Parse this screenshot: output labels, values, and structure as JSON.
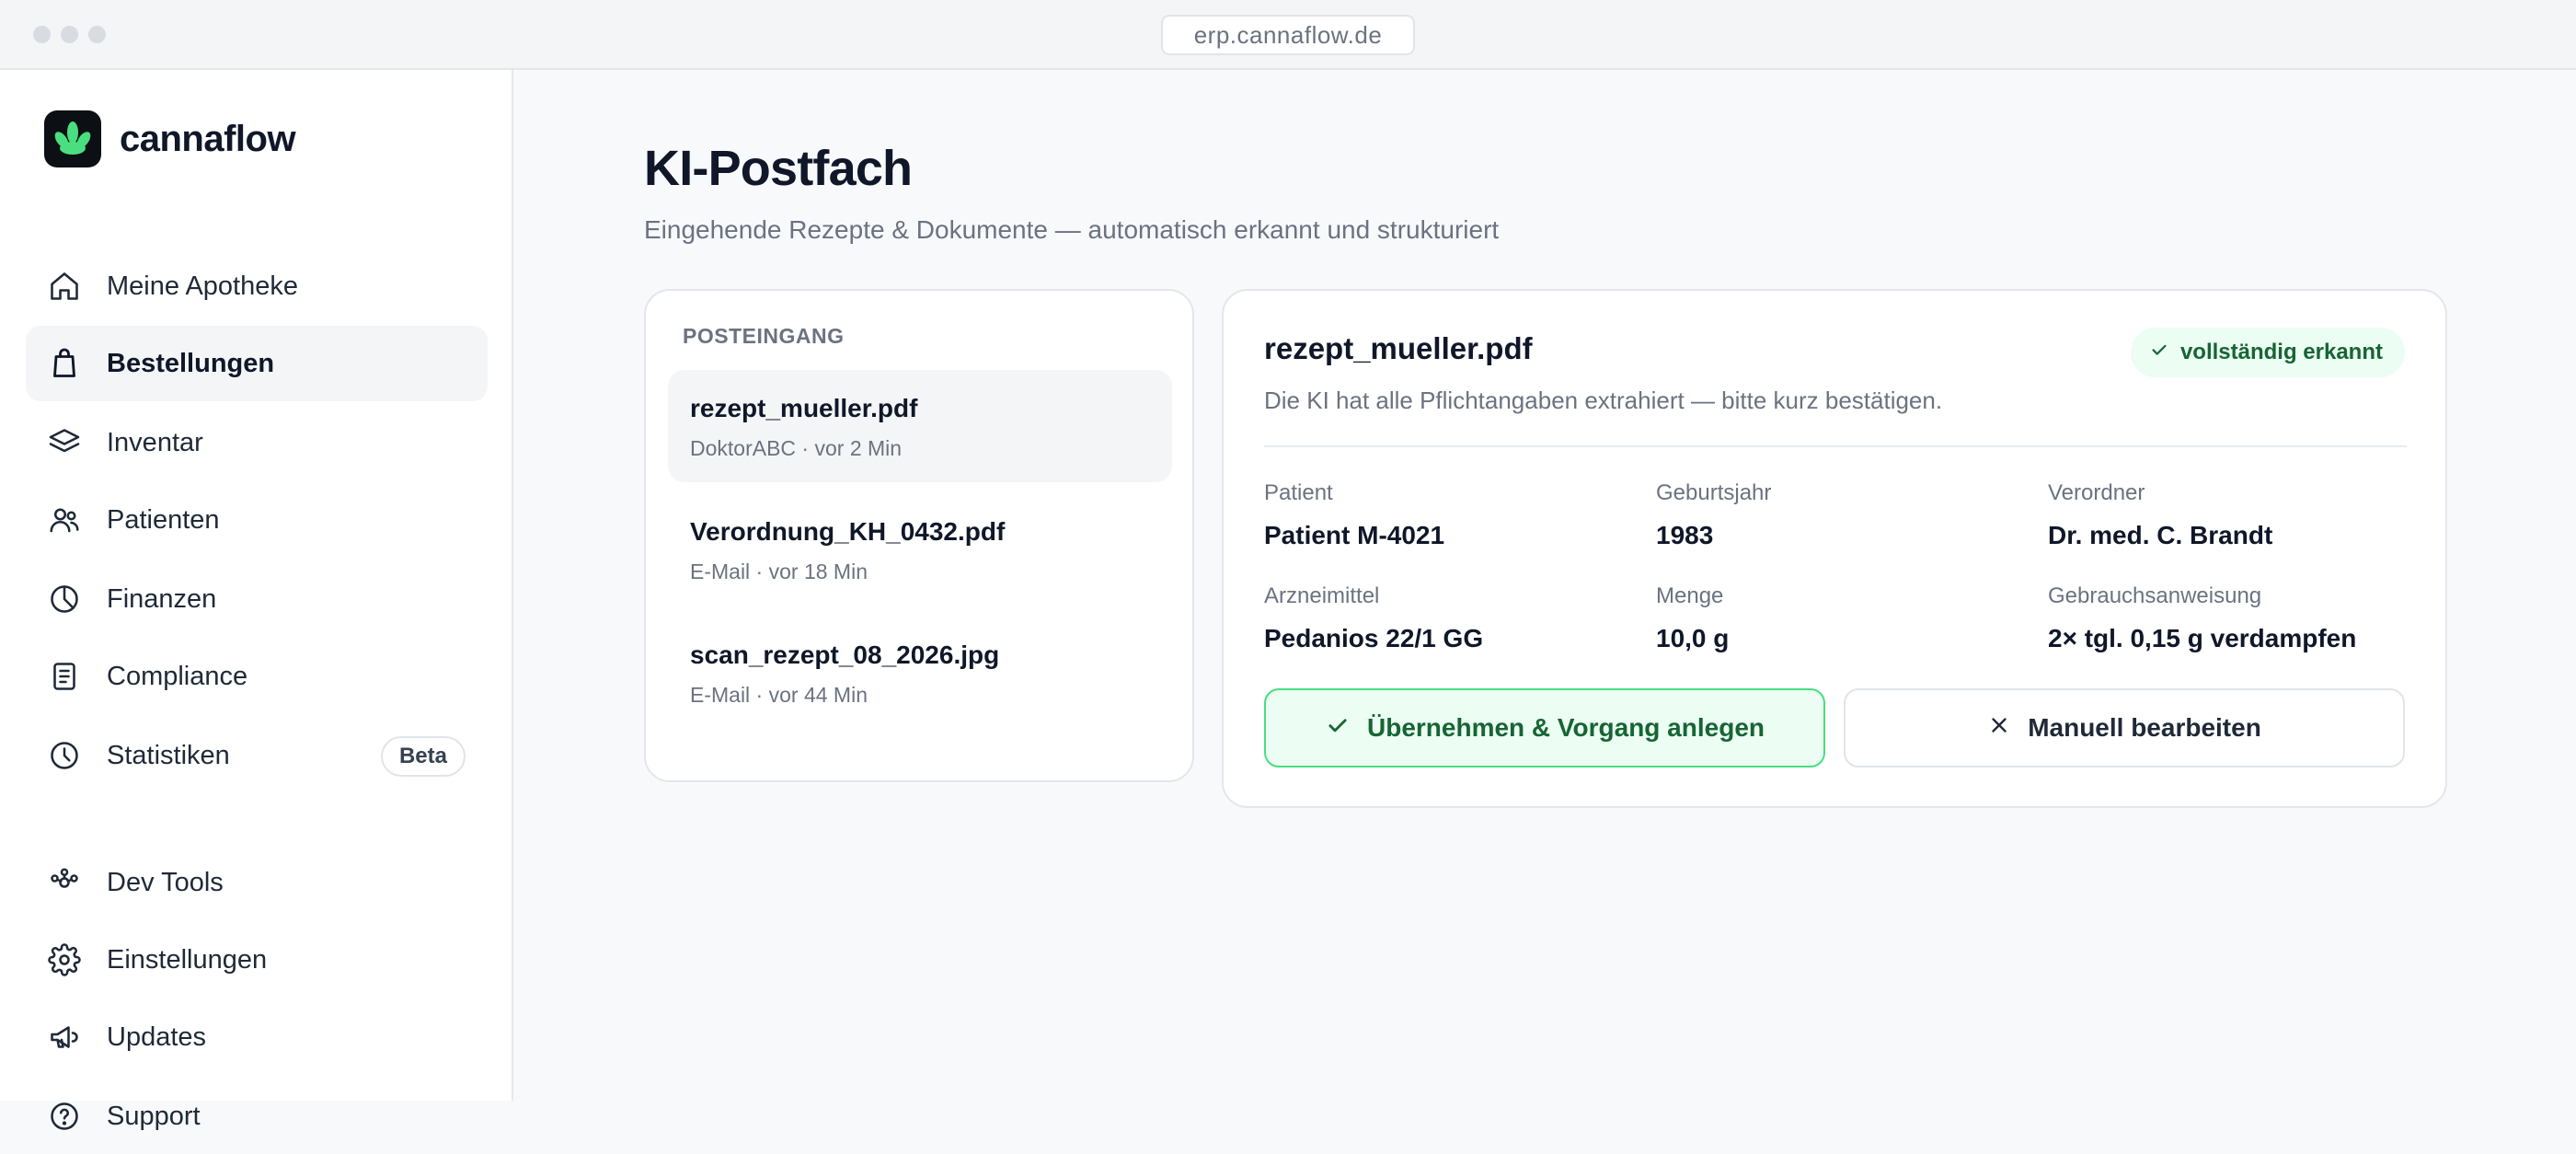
{
  "browser": {
    "url": "erp.cannaflow.de"
  },
  "brand": {
    "name": "cannaflow"
  },
  "sidebar": {
    "items": [
      {
        "label": "Meine Apotheke",
        "icon": "home-icon"
      },
      {
        "label": "Bestellungen",
        "icon": "shopping-bag-icon",
        "active": true
      },
      {
        "label": "Inventar",
        "icon": "layers-icon"
      },
      {
        "label": "Patienten",
        "icon": "users-icon"
      },
      {
        "label": "Finanzen",
        "icon": "pie-chart-icon"
      },
      {
        "label": "Compliance",
        "icon": "document-icon"
      },
      {
        "label": "Statistiken",
        "icon": "chart-icon",
        "badge": "Beta"
      },
      {
        "label": "Dev Tools",
        "icon": "dev-tools-icon"
      },
      {
        "label": "Einstellungen",
        "icon": "gear-icon"
      },
      {
        "label": "Updates",
        "icon": "megaphone-icon"
      },
      {
        "label": "Support",
        "icon": "help-circle-icon"
      }
    ]
  },
  "page": {
    "title": "KI-Postfach",
    "subtitle": "Eingehende Rezepte & Dokumente — automatisch erkannt und strukturiert"
  },
  "inbox": {
    "heading": "POSTEINGANG",
    "items": [
      {
        "name": "rezept_mueller.pdf",
        "meta": "DoktorABC · vor 2 Min",
        "active": true
      },
      {
        "name": "Verordnung_KH_0432.pdf",
        "meta": "E-Mail · vor 18 Min"
      },
      {
        "name": "scan_rezept_08_2026.jpg",
        "meta": "E-Mail · vor 44 Min"
      }
    ]
  },
  "detail": {
    "title": "rezept_mueller.pdf",
    "badge": "vollständig erkannt",
    "description": "Die KI hat alle Pflichtangaben extrahiert — bitte kurz bestätigen.",
    "fields": [
      {
        "label": "Patient",
        "value": "Patient M-4021"
      },
      {
        "label": "Geburtsjahr",
        "value": "1983"
      },
      {
        "label": "Verordner",
        "value": "Dr. med. C. Brandt"
      },
      {
        "label": "Arzneimittel",
        "value": "Pedanios 22/1 GG"
      },
      {
        "label": "Menge",
        "value": "10,0 g"
      },
      {
        "label": "Gebrauchsanweisung",
        "value": "2× tgl. 0,15 g verdampfen"
      }
    ],
    "primary_button": "Übernehmen & Vorgang anlegen",
    "secondary_button": "Manuell bearbeiten"
  },
  "colors": {
    "accent_green": "#4ade80",
    "success_text": "#166534",
    "success_bg": "#ecfdf3"
  }
}
